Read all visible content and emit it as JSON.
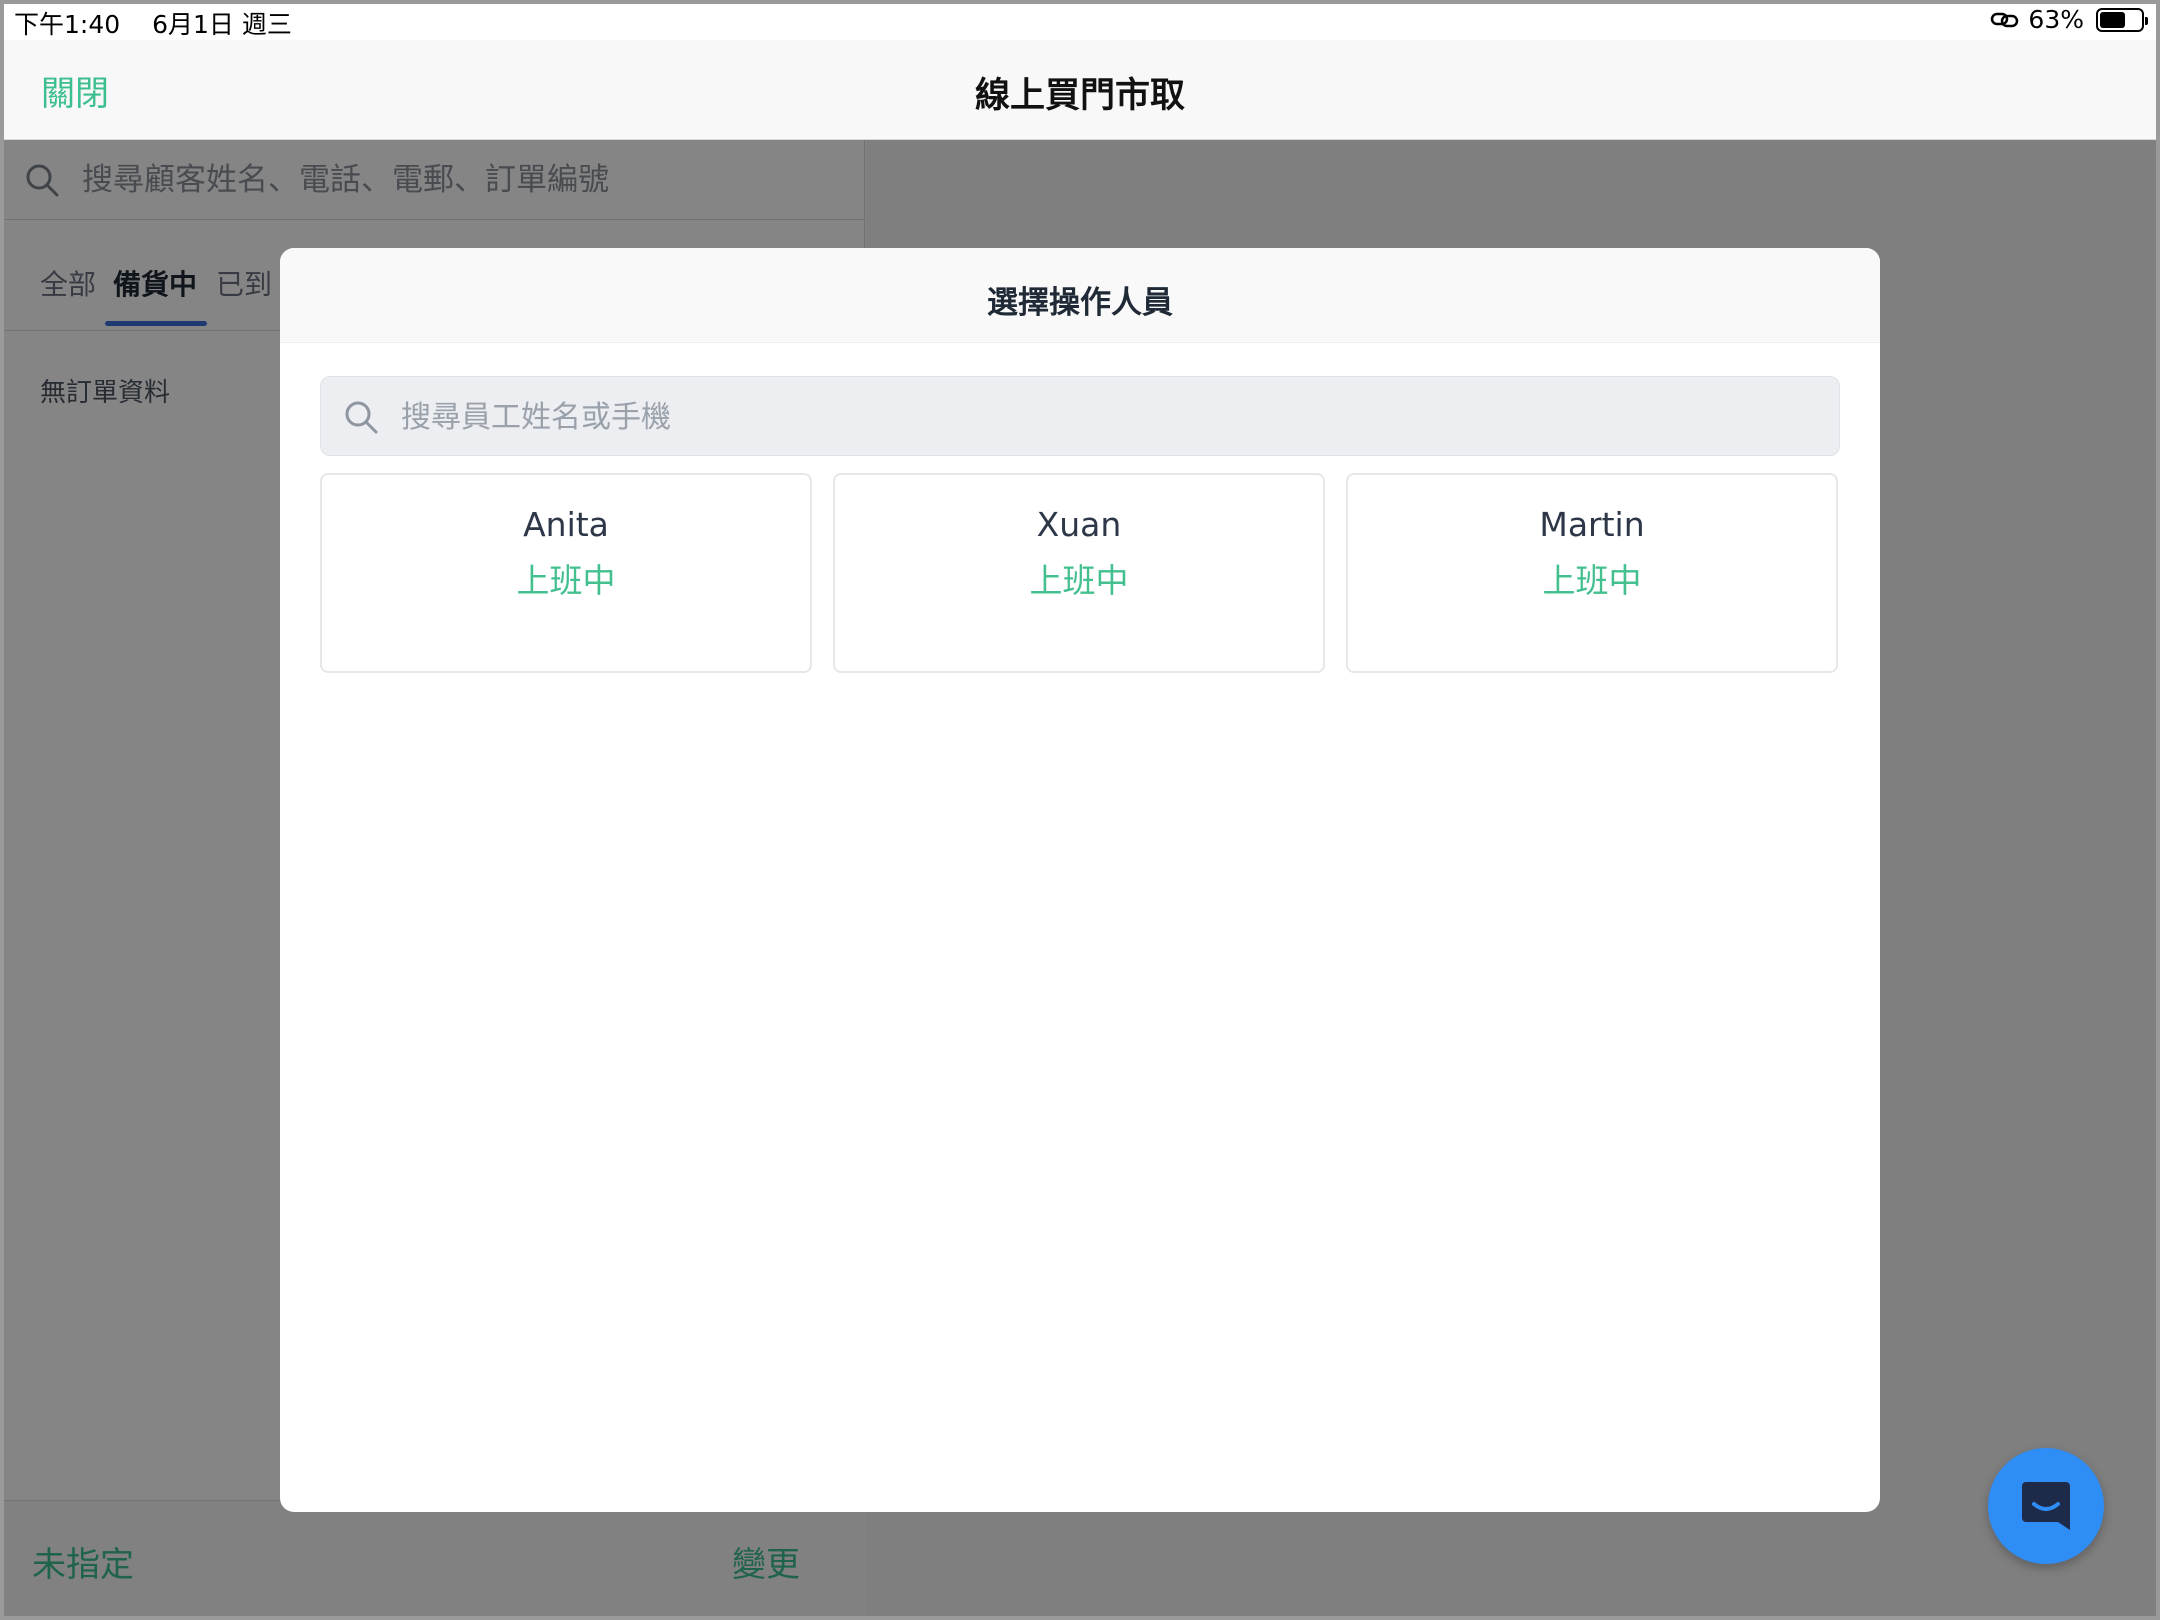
{
  "status_bar": {
    "time": "下午1:40",
    "date": "6月1日 週三",
    "battery": "63%",
    "battery_level": 0.63
  },
  "nav": {
    "close_label": "關閉",
    "title": "線上買門市取"
  },
  "background": {
    "search_placeholder": "搜尋顧客姓名、電話、電郵、訂單編號",
    "tabs": [
      {
        "label": "全部",
        "active": false
      },
      {
        "label": "備貨中",
        "active": true
      },
      {
        "label": "已到",
        "active": false
      }
    ],
    "empty_text": "無訂單資料",
    "bottom": {
      "unassigned_label": "未指定",
      "change_label": "變更"
    }
  },
  "modal": {
    "title": "選擇操作人員",
    "search_placeholder": "搜尋員工姓名或手機",
    "staff": [
      {
        "name": "Anita",
        "status": "上班中"
      },
      {
        "name": "Xuan",
        "status": "上班中"
      },
      {
        "name": "Martin",
        "status": "上班中"
      }
    ]
  },
  "icons": {
    "search": "search-icon",
    "link": "link-icon",
    "battery": "battery-icon",
    "chat": "chat-icon"
  },
  "colors": {
    "accent_green": "#3cbf8e",
    "tab_underline": "#3b6fd6",
    "chat_blue": "#2f8ef5"
  }
}
